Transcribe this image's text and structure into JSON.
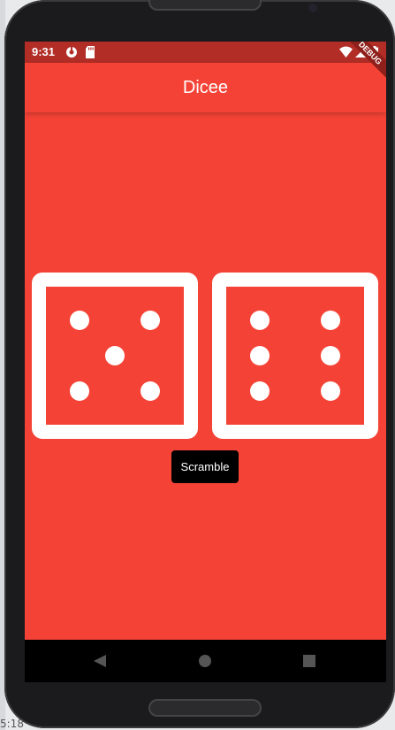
{
  "status_bar": {
    "time": "9:31",
    "left_icons": [
      "app-notification-icon",
      "sd-card-icon"
    ],
    "right_icons": [
      "wifi-icon",
      "cell-signal-icon",
      "battery-icon"
    ]
  },
  "app_bar": {
    "title": "Dicee"
  },
  "debug_banner": "DEBUG",
  "dice": {
    "left_value": 5,
    "right_value": 6
  },
  "scramble_button": {
    "label": "Scramble"
  },
  "nav_bar": {
    "buttons": [
      "back-icon",
      "home-icon",
      "recents-icon"
    ]
  },
  "desktop": {
    "clock_fragment": "5:18"
  },
  "colors": {
    "accent": "#f44336",
    "status_bar": "#b12d26",
    "die": "#ffffff",
    "button": "#000000"
  }
}
